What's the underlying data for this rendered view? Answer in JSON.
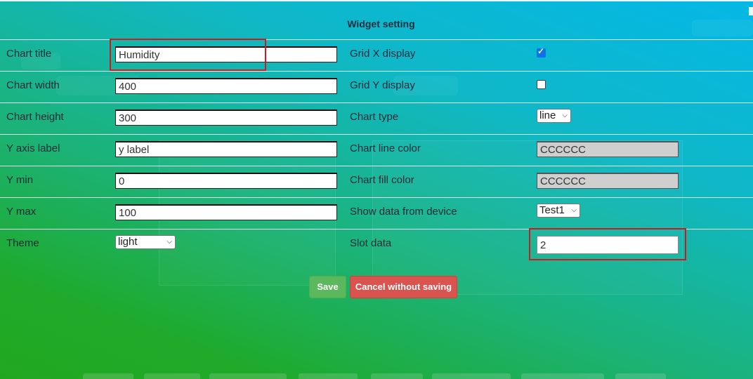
{
  "dialog": {
    "title": "Widget setting",
    "fields": {
      "chart_title": {
        "label": "Chart title",
        "value": "Humidity"
      },
      "chart_width": {
        "label": "Chart width",
        "value": "400"
      },
      "chart_height": {
        "label": "Chart height",
        "value": "300"
      },
      "y_axis_label": {
        "label": "Y axis label",
        "value": "y label"
      },
      "y_min": {
        "label": "Y min",
        "value": "0"
      },
      "y_max": {
        "label": "Y max",
        "value": "100"
      },
      "theme": {
        "label": "Theme",
        "value": "light"
      },
      "grid_x": {
        "label": "Grid X display",
        "checked": true
      },
      "grid_y": {
        "label": "Grid Y display",
        "checked": false
      },
      "chart_type": {
        "label": "Chart type",
        "value": "line"
      },
      "line_color": {
        "label": "Chart line color",
        "value": "CCCCCC"
      },
      "fill_color": {
        "label": "Chart fill color",
        "value": "CCCCCC"
      },
      "device": {
        "label": "Show data from device",
        "value": "Test1"
      },
      "slot": {
        "label": "Slot data",
        "value": "2"
      }
    },
    "buttons": {
      "save": "Save",
      "cancel": "Cancel without saving"
    }
  },
  "colors": {
    "highlight": "#d0191c",
    "save": "#5cb85c",
    "cancel": "#d9534f",
    "checkbox": "#0b72e7"
  }
}
